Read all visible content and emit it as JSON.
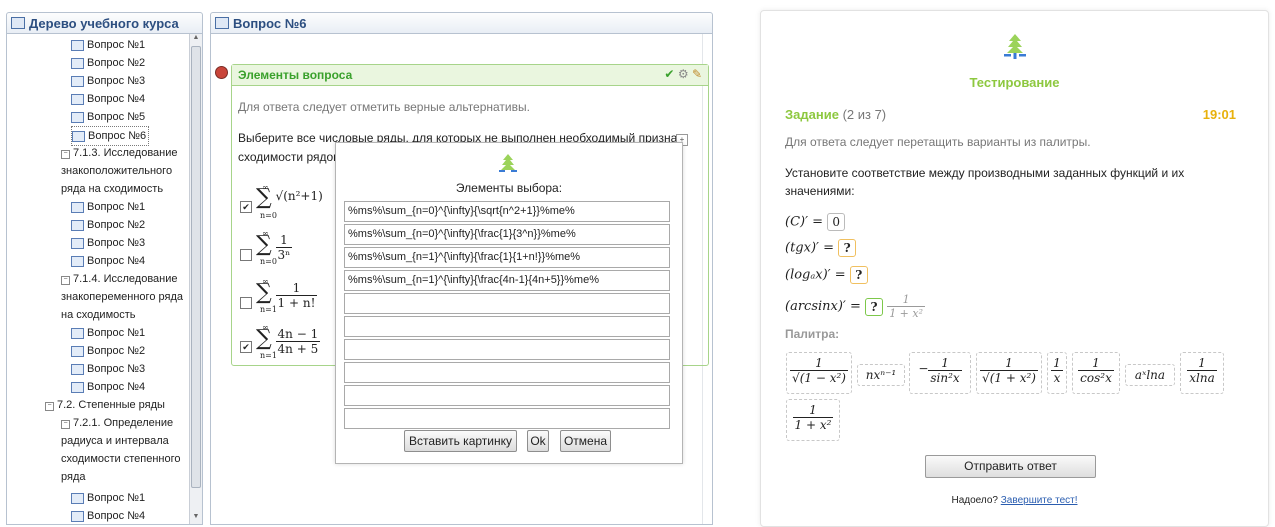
{
  "tree": {
    "title": "Дерево учебного курса",
    "items_a": [
      "Вопрос №1",
      "Вопрос №2",
      "Вопрос №3",
      "Вопрос №4",
      "Вопрос №5",
      "Вопрос №6"
    ],
    "sec_713": "7.1.3. Исследование",
    "sec_713_l2": "знакоположительного",
    "sec_713_l3": "ряда на сходимость",
    "items_b": [
      "Вопрос №1",
      "Вопрос №2",
      "Вопрос №3",
      "Вопрос №4"
    ],
    "sec_714": "7.1.4. Исследование",
    "sec_714_l2": "знакопеременного ряда",
    "sec_714_l3": "на сходимость",
    "items_c": [
      "Вопрос №1",
      "Вопрос №2",
      "Вопрос №3",
      "Вопрос №4"
    ],
    "sec_72": "7.2. Степенные ряды",
    "sec_721": "7.2.1. Определение",
    "sec_721_l2": "радиуса и интервала",
    "sec_721_l3": "сходимости степенного",
    "sec_721_l4": "ряда",
    "items_d": [
      "Вопрос №1",
      "Вопрос №4"
    ]
  },
  "question": {
    "title": "Вопрос №6",
    "box_title": "Элементы вопроса",
    "hint": "Для ответа следует отметить верные альтернативы.",
    "text": "Выберите все числовые ряды, для которых не выполнен необходимый признак сходимости рядов:",
    "options": [
      {
        "checked": true,
        "upper": "∞",
        "lower": "n=0",
        "expr": "√(n²+1)"
      },
      {
        "checked": false,
        "upper": "∞",
        "lower": "n=0",
        "num": "1",
        "den": "3ⁿ"
      },
      {
        "checked": false,
        "upper": "∞",
        "lower": "n=1",
        "num": "1",
        "den": "1 + n!"
      },
      {
        "checked": true,
        "upper": "∞",
        "lower": "n=1",
        "num": "4n − 1",
        "den": "4n + 5"
      }
    ]
  },
  "dialog": {
    "title": "Элементы выбора:",
    "items": [
      "%ms%\\sum_{n=0}^{\\infty}{\\sqrt{n^2+1}}%me%",
      "%ms%\\sum_{n=0}^{\\infty}{\\frac{1}{3^n}}%me%",
      "%ms%\\sum_{n=1}^{\\infty}{\\frac{1}{1+n!}}%me%",
      "%ms%\\sum_{n=1}^{\\infty}{\\frac{4n-1}{4n+5}}%me%",
      "",
      "",
      "",
      "",
      "",
      ""
    ],
    "insert_image": "Вставить картинку",
    "ok": "Ok",
    "cancel": "Отмена"
  },
  "test": {
    "label": "Тестирование",
    "task_word": "Задание",
    "task_count": "(2 из 7)",
    "timer": "19:01",
    "hint": "Для ответа следует перетащить варианты из палитры.",
    "text": "Установите соответствие между производными заданных функций и их значениями:",
    "eq1": "(C)′ =",
    "eq1_val": "0",
    "eq2": "(tgx)′ =",
    "eq3": "(logₐx)′ =",
    "eq4": "(arcsinx)′ =",
    "slot": "?",
    "drag_num": "1",
    "drag_den": "1 + x²",
    "palette_label": "Палитра:",
    "palette": [
      {
        "num": "1",
        "den": "√(1 − x²)"
      },
      {
        "text": "nxⁿ⁻¹"
      },
      {
        "text": "−",
        "num": "1",
        "den": "sin²x"
      },
      {
        "num": "1",
        "den": "√(1 + x²)"
      },
      {
        "num": "1",
        "den": "x"
      },
      {
        "num": "1",
        "den": "cos²x"
      },
      {
        "text": "aˣlna"
      },
      {
        "num": "1",
        "den": "xlna"
      },
      {
        "num": "1",
        "den": "1 + x²"
      }
    ],
    "send": "Отправить ответ",
    "bored": "Надоело?",
    "bored_link": "Завершите тест!"
  }
}
